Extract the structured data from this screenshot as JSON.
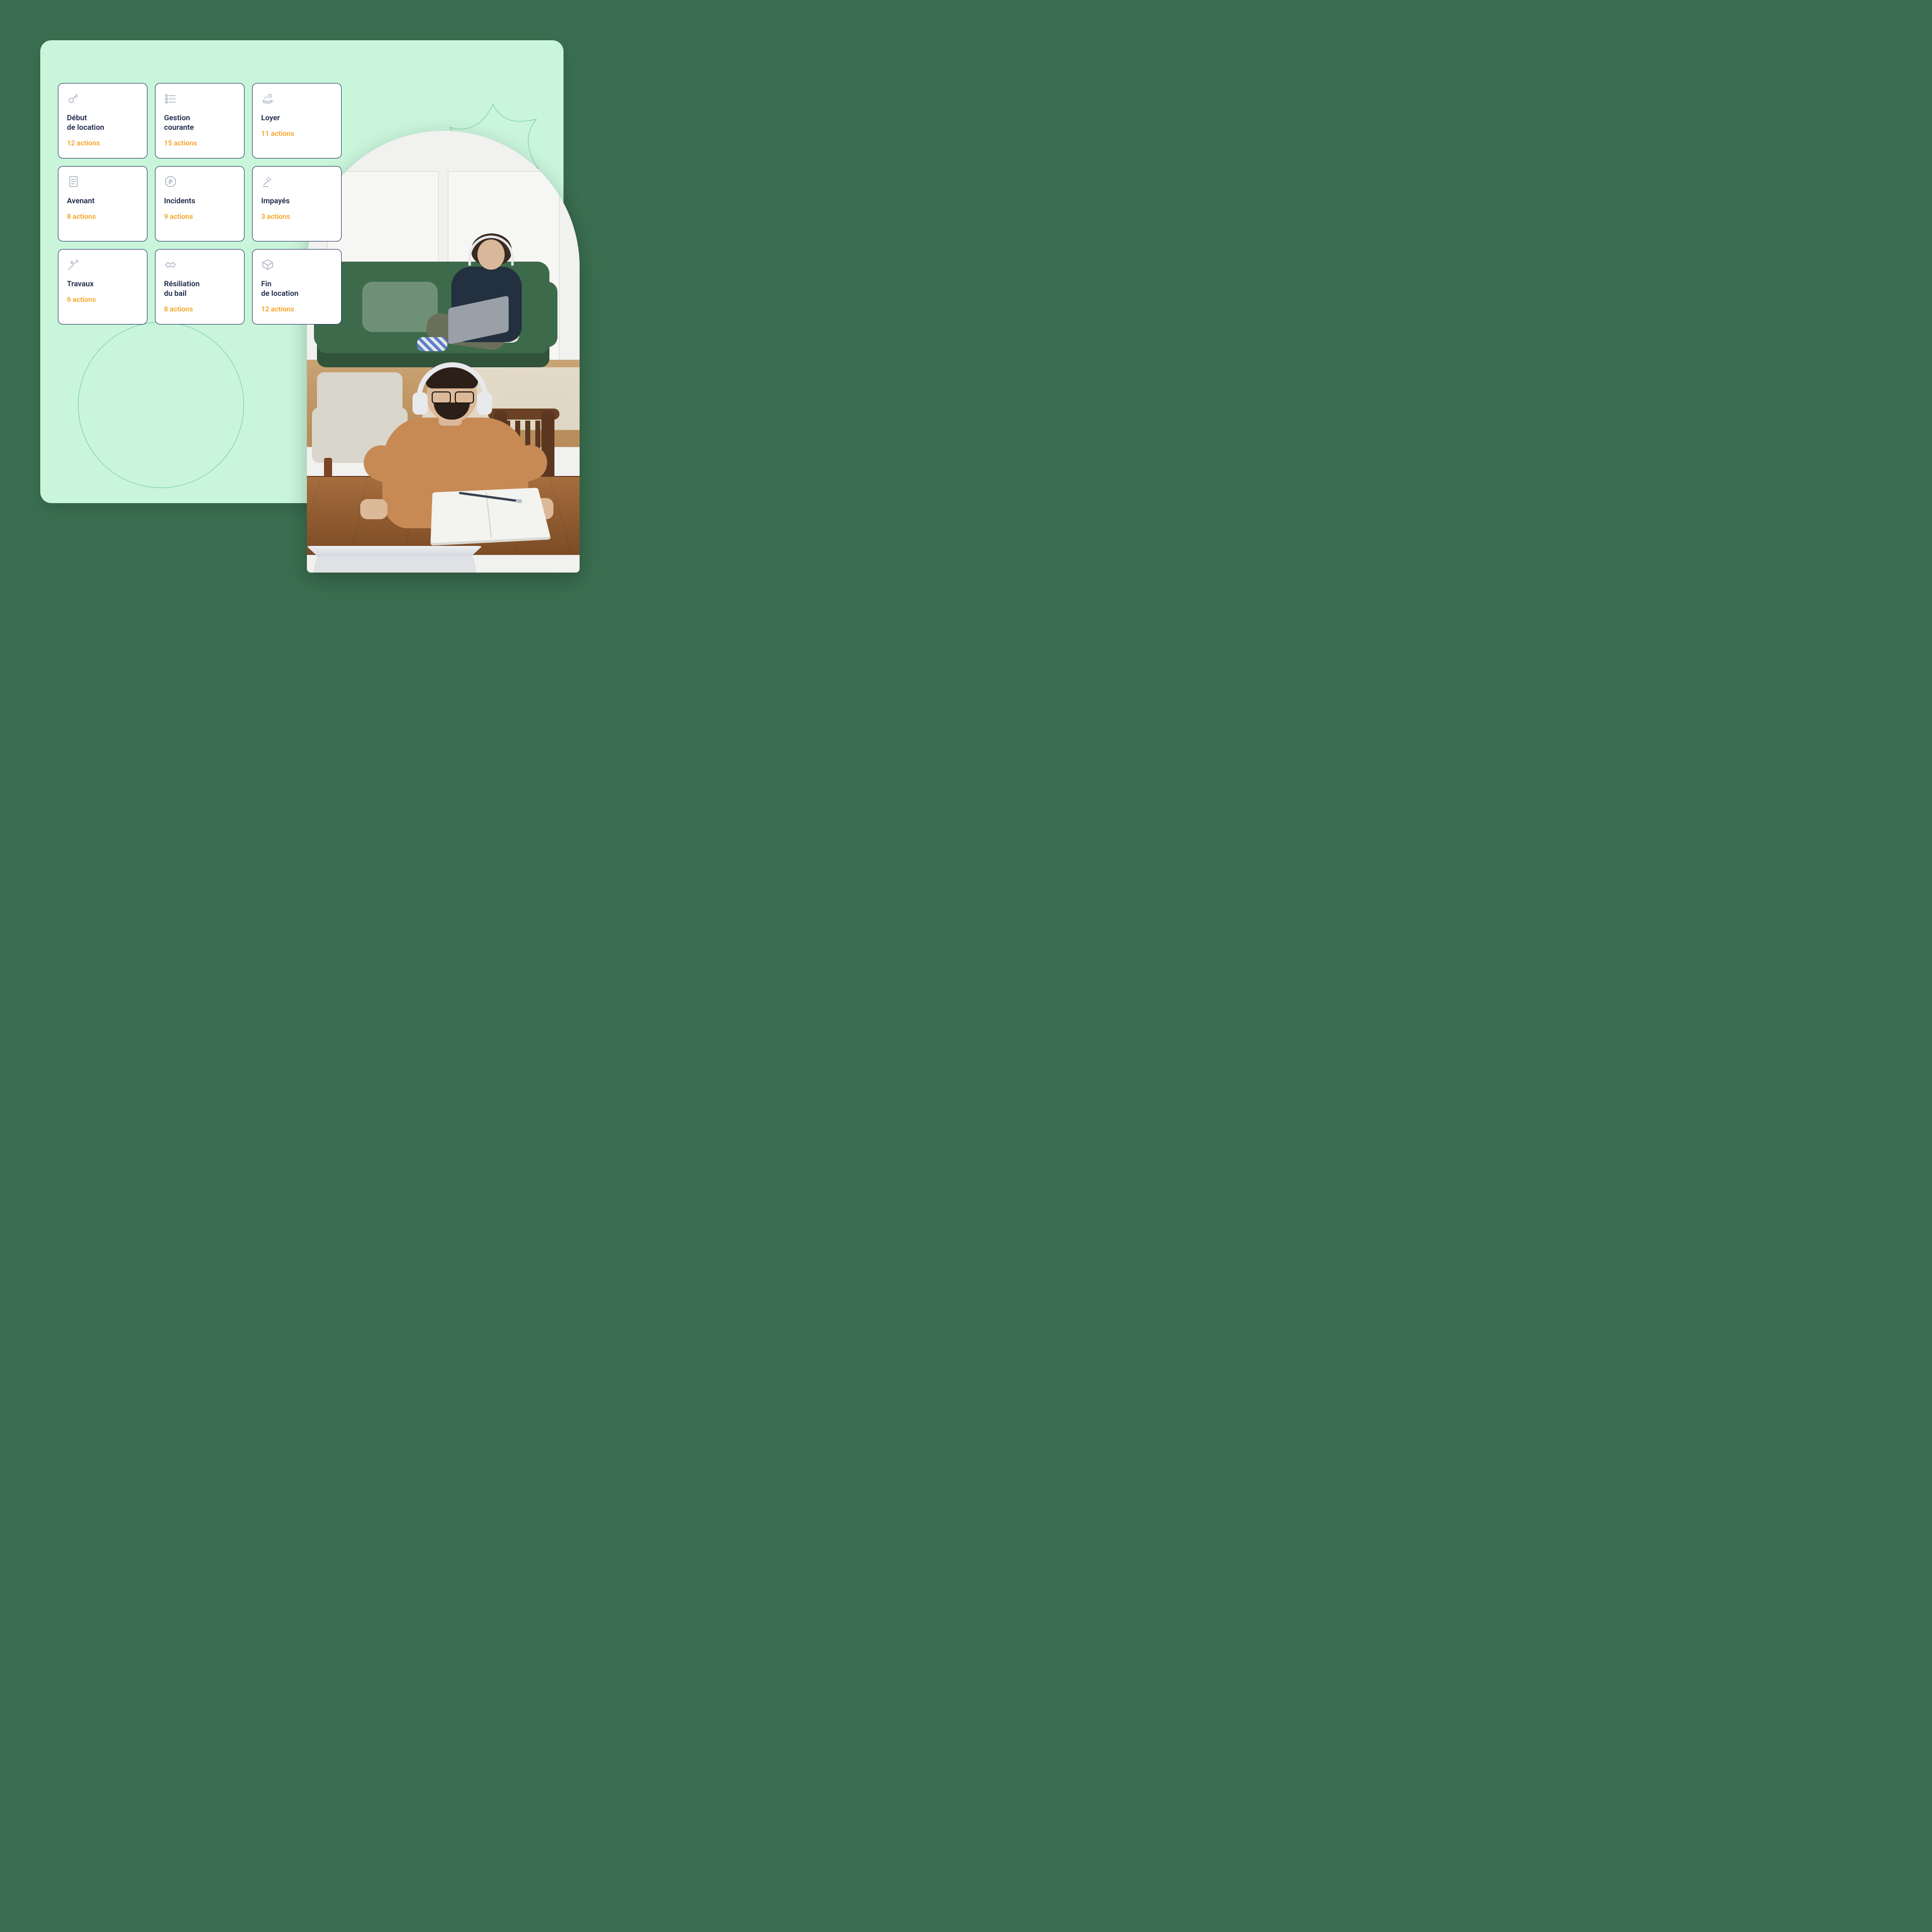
{
  "colors": {
    "page_bg": "#3b6e50",
    "panel_bg": "#c9f5db",
    "card_bg": "#ffffff",
    "card_border": "#26355f",
    "title": "#1f2a4a",
    "count": "#f4a528",
    "icon": "#a8b0c2",
    "deco_stroke": "#6fc8a2"
  },
  "cards": [
    {
      "icon": "key-icon",
      "title": "Début\nde location",
      "count": "12 actions"
    },
    {
      "icon": "list-icon",
      "title": "Gestion\ncourante",
      "count": "15 actions"
    },
    {
      "icon": "coins-icon",
      "title": "Loyer",
      "count": "11 actions"
    },
    {
      "icon": "document-icon",
      "title": "Avenant",
      "count": "8 actions"
    },
    {
      "icon": "stop-hand-icon",
      "title": "Incidents",
      "count": "9 actions"
    },
    {
      "icon": "gavel-icon",
      "title": "Impayés",
      "count": "3 actions"
    },
    {
      "icon": "tools-icon",
      "title": "Travaux",
      "count": "6 actions"
    },
    {
      "icon": "handshake-icon",
      "title": "Résiliation\ndu bail",
      "count": "8 actions"
    },
    {
      "icon": "box-icon",
      "title": "Fin\nde location",
      "count": "12 actions"
    }
  ]
}
